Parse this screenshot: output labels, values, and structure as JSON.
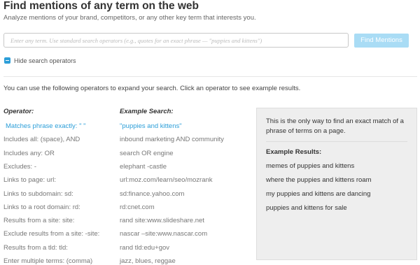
{
  "header": {
    "title": "Find mentions of any term on the web",
    "subtitle": "Analyze mentions of your brand, competitors, or any other key term that interests you."
  },
  "search": {
    "placeholder": "Enter any term. Use standard search operators (e.g., quotes for an exact phrase — \"puppies and kittens\")",
    "button_label": "Find Mentions"
  },
  "toggle": {
    "label": "Hide search operators"
  },
  "intro": "You can use the following operators to expand your search. Click an operator to see example results.",
  "columns": {
    "operator": "Operator:",
    "example": "Example Search:"
  },
  "operators": [
    {
      "operator": "Matches phrase exactly: \" \"",
      "example": "\"puppies and kittens\"",
      "active": true
    },
    {
      "operator": "Includes all: (space), AND",
      "example": "inbound marketing AND community"
    },
    {
      "operator": "Includes any: OR",
      "example": "search OR engine"
    },
    {
      "operator": "Excludes: -",
      "example": "elephant -castle"
    },
    {
      "operator": "Links to page: url:",
      "example": "url:moz.com/learn/seo/mozrank"
    },
    {
      "operator": "Links to subdomain: sd:",
      "example": "sd:finance.yahoo.com"
    },
    {
      "operator": "Links to a root domain: rd:",
      "example": "rd:cnet.com"
    },
    {
      "operator": "Results from a site: site:",
      "example": "rand site:www.slideshare.net"
    },
    {
      "operator": "Exclude results from a site: -site:",
      "example": "nascar –site:www.nascar.com"
    },
    {
      "operator": "Results from a tld: tld:",
      "example": "rand tld:edu+gov"
    },
    {
      "operator": "Enter multiple terms: (comma)",
      "example": "jazz, blues, reggae"
    }
  ],
  "panel": {
    "description": "This is the only way to find an exact match of a phrase of terms on a page.",
    "results_heading": "Example Results:",
    "results": [
      "memes of puppies and kittens",
      "where the puppies and kittens roam",
      "my puppies and kittens are dancing",
      "puppies and kittens for sale"
    ]
  },
  "colors": {
    "accent": "#2c9ed8",
    "button": "#a9dcf5",
    "panel": "#eeeeee"
  },
  "icons": {
    "toggle": "minus-square-icon"
  }
}
